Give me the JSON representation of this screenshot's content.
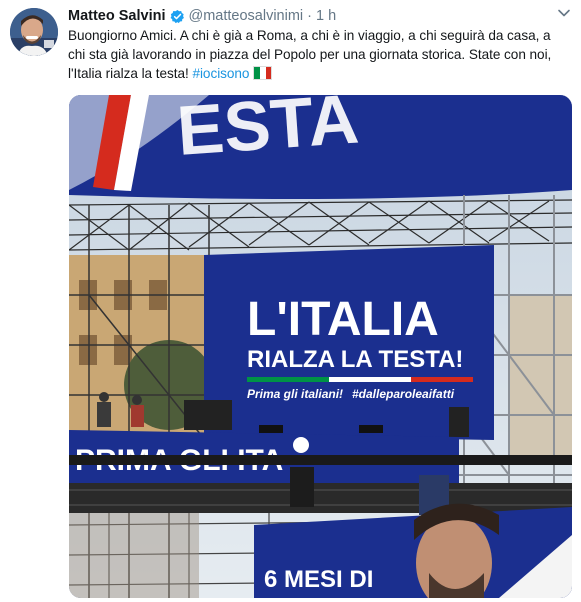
{
  "tweet": {
    "author_name": "Matteo Salvini",
    "author_handle": "@matteosalvinimi",
    "separator": "·",
    "time": "1 h",
    "text_main": "Buongiorno Amici. A chi è già a Roma, a chi è in viaggio, a chi seguirà da casa, a chi sta già lavorando in piazza del Popolo per una giornata storica. State con noi, l'Italia rialza la testa! ",
    "hashtag": "#iocisono",
    "flag_icon": "italy-flag-icon"
  },
  "photo": {
    "banner_line1": "L'ITALIA",
    "banner_line2": "RIALZA LA TESTA!",
    "banner_slogan_left": "Prima gli italiani!",
    "banner_slogan_right": "#dalleparoleaifatti",
    "lower_banner_text": "PRIMA GLI ITA",
    "bottom_banner_text": "6 MESI DI",
    "colors": {
      "blue": "#1b2f8f",
      "red": "#d52b1e",
      "green": "#009246"
    }
  }
}
